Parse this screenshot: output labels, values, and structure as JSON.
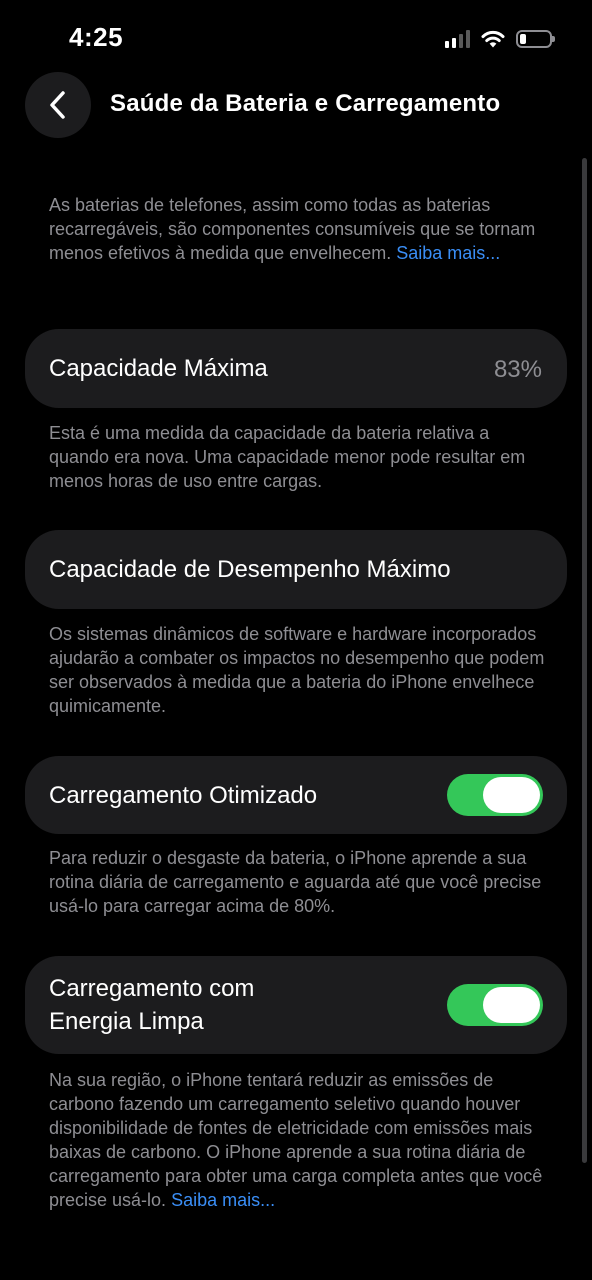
{
  "status_bar": {
    "time": "4:25",
    "battery_level_fraction": 0.2
  },
  "nav": {
    "title": "Saúde da Bateria e Carregamento"
  },
  "intro": {
    "text": "As baterias de telefones, assim como todas as baterias recarregáveis, são componentes consumíveis que se tornam menos efetivos à medida que envelhecem.",
    "link": "Saiba mais..."
  },
  "max_capacity": {
    "label": "Capacidade Máxima",
    "value": "83%",
    "description": "Esta é uma medida da capacidade da bateria relativa a quando era nova. Uma capacidade menor pode resultar em menos horas de uso entre cargas."
  },
  "peak_performance": {
    "label": "Capacidade de Desempenho Máximo",
    "description": "Os sistemas dinâmicos de software e hardware incorporados ajudarão a combater os impactos no desempenho que podem ser observados à medida que a bateria do iPhone envelhece quimicamente."
  },
  "optimized_charging": {
    "label": "Carregamento Otimizado",
    "enabled": true,
    "description": "Para reduzir o desgaste da bateria, o iPhone aprende a sua rotina diária de carregamento e aguarda até que você precise usá-lo para carregar acima de 80%."
  },
  "clean_energy": {
    "label_line1": "Carregamento com",
    "label_line2": "Energia Limpa",
    "enabled": true,
    "description": "Na sua região, o iPhone tentará reduzir as emissões de carbono fazendo um carregamento seletivo quando houver disponibilidade de fontes de eletricidade com emissões mais baixas de carbono. O iPhone aprende a sua rotina diária de carregamento para obter uma carga completa antes que você precise usá-lo.",
    "link": "Saiba mais..."
  },
  "colors": {
    "background": "#000000",
    "card": "#1c1c1e",
    "secondary_text": "#8e8e93",
    "link": "#3a8ef6",
    "toggle_on": "#34c759"
  }
}
